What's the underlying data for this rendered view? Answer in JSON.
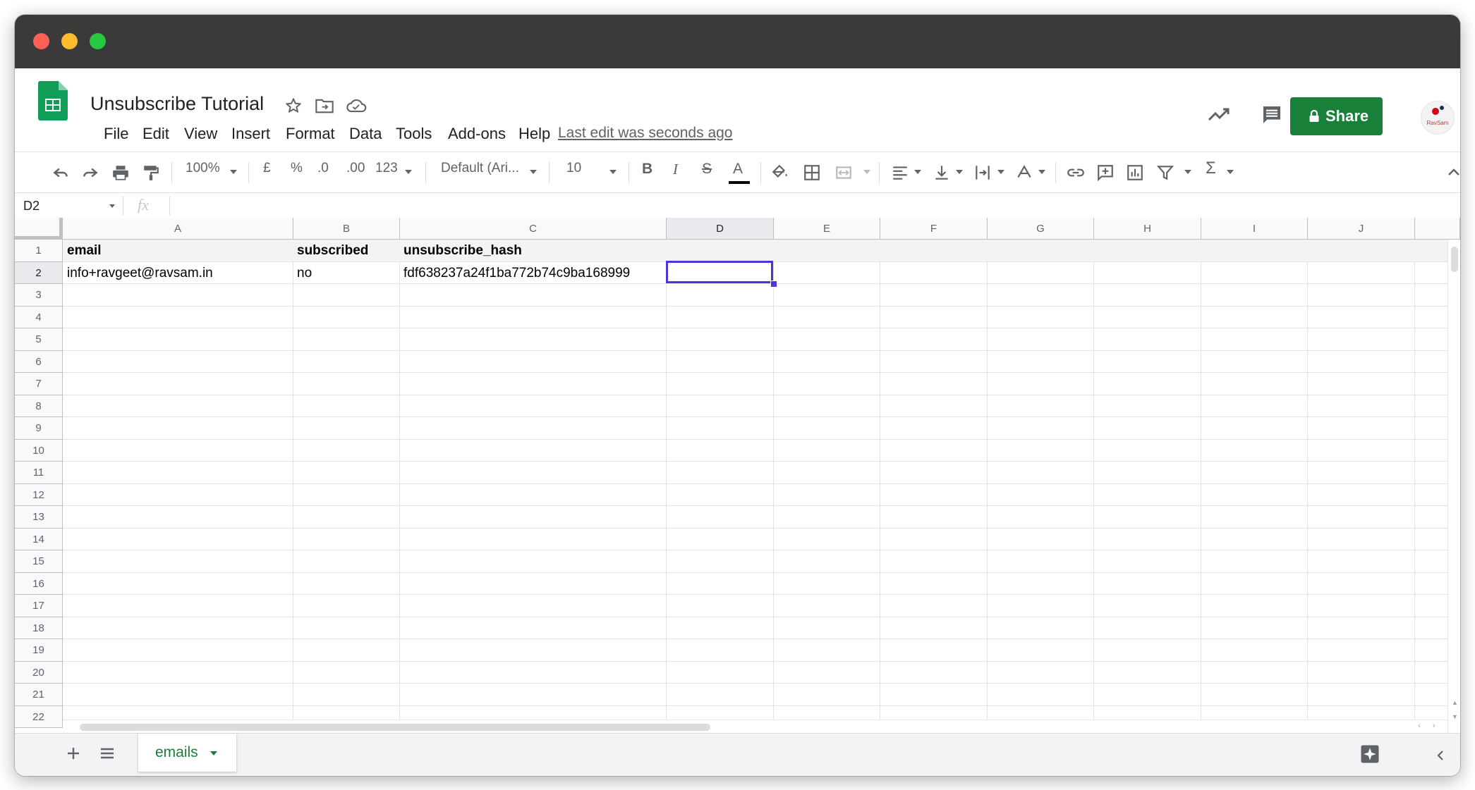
{
  "window": {
    "traffic_lights": {
      "close": "#fe5f57",
      "minimize": "#febc2e",
      "zoom": "#28c840"
    }
  },
  "app": {
    "doc_title": "Unsubscribe Tutorial",
    "last_edit": "Last edit was seconds ago",
    "share_label": "Share",
    "accent": "#188038",
    "avatar_text": "RavSam",
    "menu": [
      "File",
      "Edit",
      "View",
      "Insert",
      "Format",
      "Data",
      "Tools",
      "Add-ons",
      "Help"
    ]
  },
  "toolbar": {
    "zoom": "100%",
    "currency": "£",
    "percent": "%",
    "dec_decrease": ".0",
    "dec_increase": ".00",
    "more_formats": "123",
    "font": "Default (Ari...",
    "font_size": "10",
    "bold": "B",
    "italic": "I",
    "strike": "S",
    "text_color": "A",
    "functions": "Σ"
  },
  "formula_bar": {
    "name_box": "D2",
    "fx": "fx",
    "value": ""
  },
  "grid": {
    "columns": [
      "A",
      "B",
      "C",
      "D",
      "E",
      "F",
      "G",
      "H",
      "I",
      "J"
    ],
    "rows": [
      "1",
      "2",
      "3",
      "4",
      "5",
      "6",
      "7",
      "8",
      "9",
      "10",
      "11",
      "12",
      "13",
      "14",
      "15",
      "16",
      "17",
      "18",
      "19",
      "20",
      "21",
      "22"
    ],
    "selected_cell": "D2",
    "cells": {
      "A1": "email",
      "B1": "subscribed",
      "C1": "unsubscribe_hash",
      "A2": "info+ravgeet@ravsam.in",
      "B2": "no",
      "C2": "fdf638237a24f1ba772b74c9ba168999"
    }
  },
  "sheets": {
    "active": "emails"
  }
}
